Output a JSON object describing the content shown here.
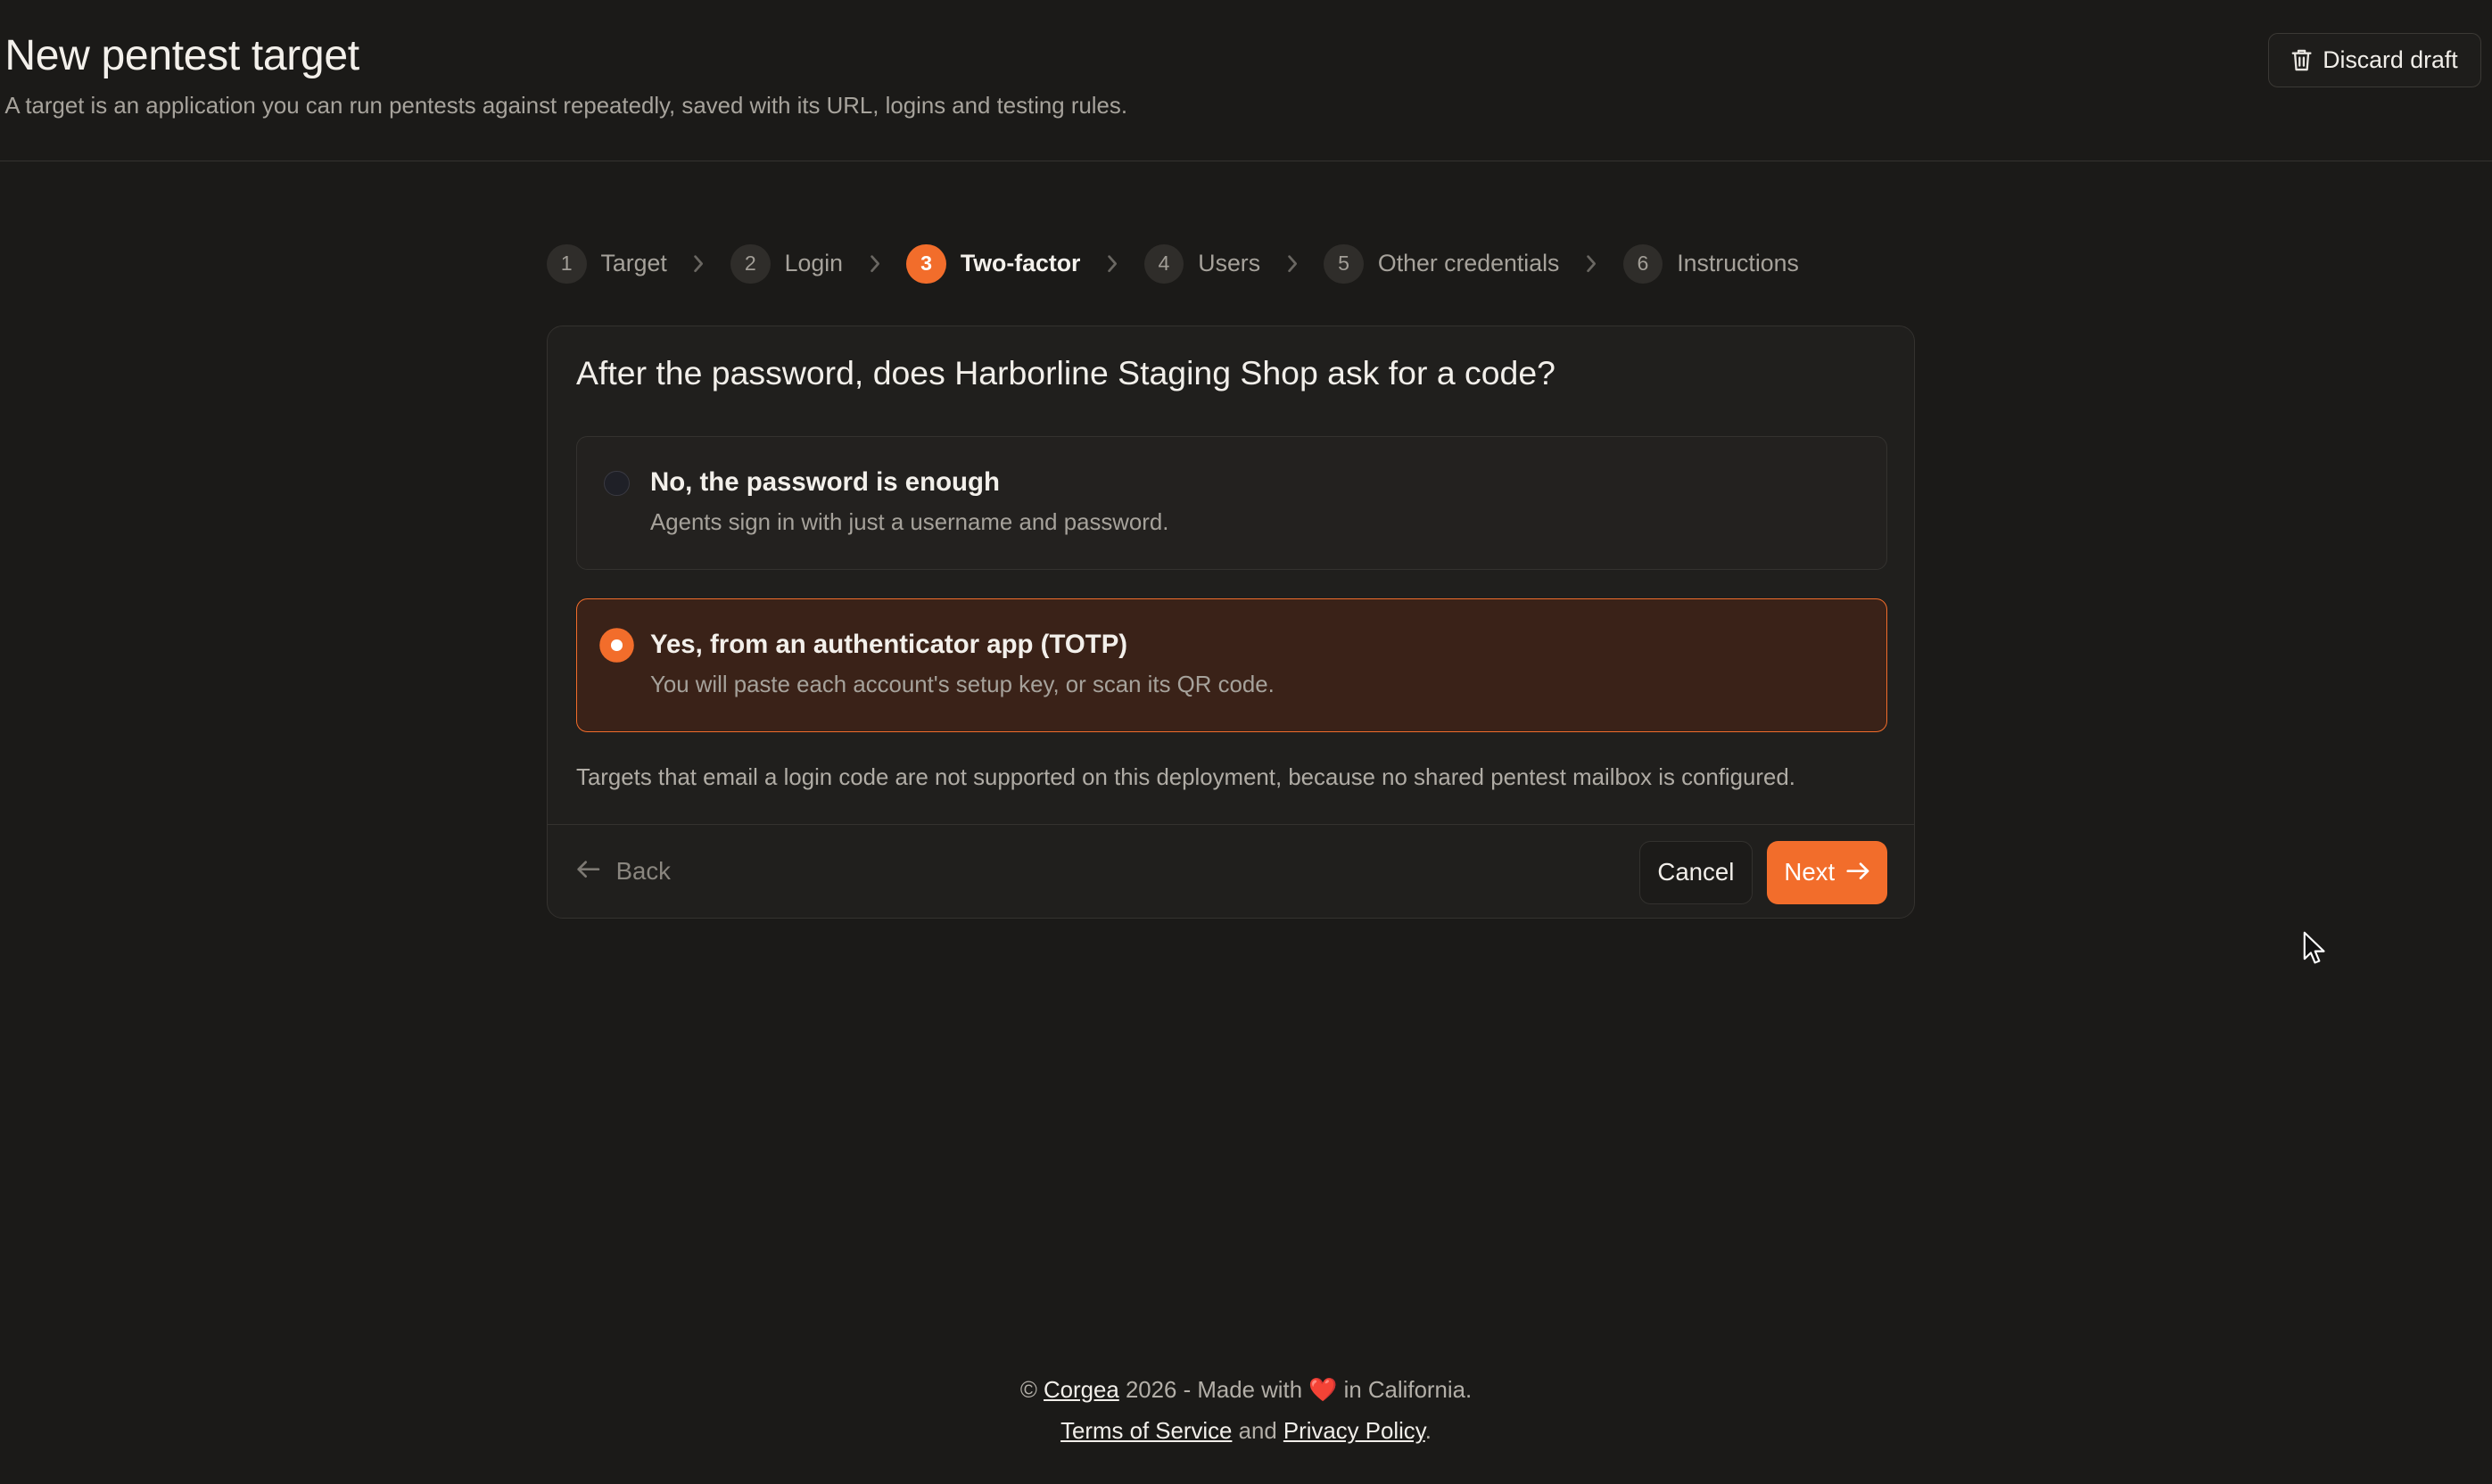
{
  "header": {
    "title": "New pentest target",
    "subtitle": "A target is an application you can run pentests against repeatedly, saved with its URL, logins and testing rules.",
    "discard_label": "Discard draft"
  },
  "stepper": {
    "steps": [
      {
        "num": "1",
        "label": "Target"
      },
      {
        "num": "2",
        "label": "Login"
      },
      {
        "num": "3",
        "label": "Two-factor"
      },
      {
        "num": "4",
        "label": "Users"
      },
      {
        "num": "5",
        "label": "Other credentials"
      },
      {
        "num": "6",
        "label": "Instructions"
      }
    ],
    "active_step": 3
  },
  "card": {
    "question": "After the password, does Harborline Staging Shop ask for a code?",
    "options": [
      {
        "title": "No, the password is enough",
        "description": "Agents sign in with just a username and password.",
        "selected": false
      },
      {
        "title": "Yes, from an authenticator app (TOTP)",
        "description": "You will paste each account's setup key, or scan its QR code.",
        "selected": true
      }
    ],
    "note": "Targets that email a login code are not supported on this deployment, because no shared pentest mailbox is configured.",
    "back_label": "Back",
    "cancel_label": "Cancel",
    "next_label": "Next"
  },
  "footer": {
    "copyright_symbol": "©",
    "company_link": "Corgea",
    "made_with_prefix": "2026 - Made with",
    "heart": "❤️",
    "made_with_suffix": "in California.",
    "terms_link": "Terms of Service",
    "and_text": "and",
    "privacy_link": "Privacy Policy",
    "period": "."
  },
  "colors": {
    "background": "#1b1a18",
    "accent": "#f26d2b",
    "selected_option_bg": "#3a2218",
    "card_bg": "#201f1d"
  },
  "icons": {
    "discard": "trash-icon",
    "step_separator": "chevron-right-icon",
    "back": "arrow-left-icon",
    "next": "arrow-right-icon",
    "cursor": "mouse-pointer-icon"
  }
}
